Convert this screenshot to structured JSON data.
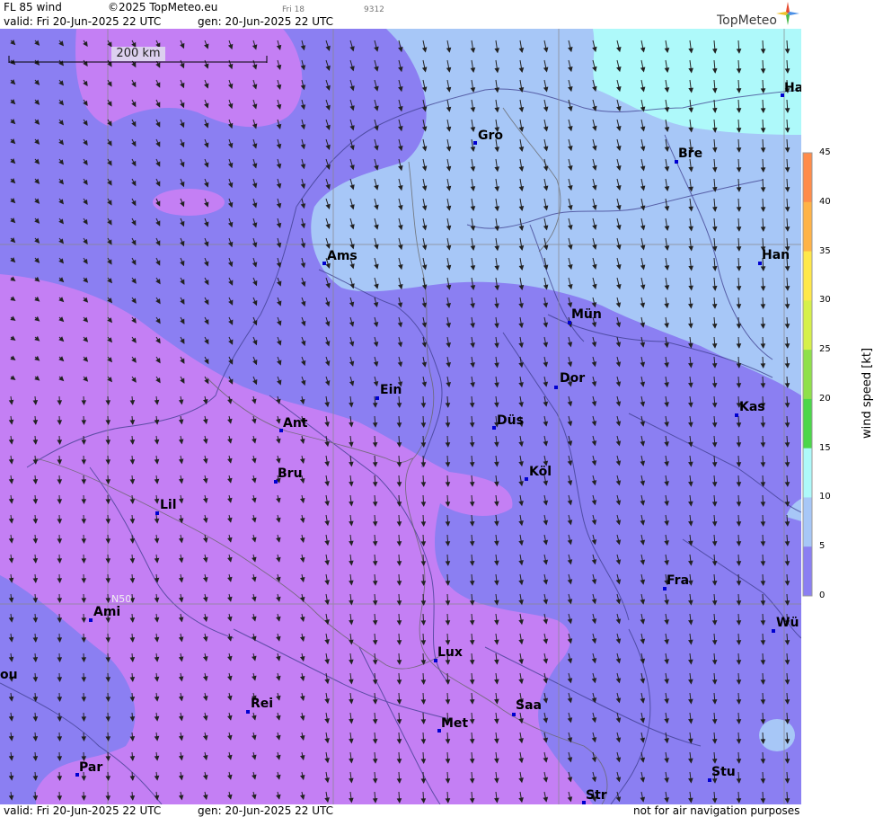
{
  "header": {
    "product": "FL 85 wind",
    "copyright": "©2025 TopMeteo.eu",
    "frame": "Fri 18",
    "code": "9312",
    "valid": "valid:  Fri  20-Jun-2025  22 UTC",
    "gen": "gen: 20-Jun-2025  22 UTC",
    "brand": "TopMeteo"
  },
  "footer": {
    "valid": "valid:  Fri  20-Jun-2025  22 UTC",
    "gen": "gen: 20-Jun-2025  22 UTC",
    "disclaimer": "not for air navigation purposes"
  },
  "map": {
    "scale_label": "200 km",
    "latitude_label": "N50",
    "cities": [
      {
        "name": "Gro"
      },
      {
        "name": "Bre"
      },
      {
        "name": "Ha"
      },
      {
        "name": "Ams"
      },
      {
        "name": "Han"
      },
      {
        "name": "Mün"
      },
      {
        "name": "Dor"
      },
      {
        "name": "Ein"
      },
      {
        "name": "Kas"
      },
      {
        "name": "Düs"
      },
      {
        "name": "Ant"
      },
      {
        "name": "Bru"
      },
      {
        "name": "Köl"
      },
      {
        "name": "Lil"
      },
      {
        "name": "Fra"
      },
      {
        "name": "Ami"
      },
      {
        "name": "Wü"
      },
      {
        "name": "Lux"
      },
      {
        "name": "ou"
      },
      {
        "name": "Rei"
      },
      {
        "name": "Saa"
      },
      {
        "name": "Met"
      },
      {
        "name": "Par"
      },
      {
        "name": "Stu"
      },
      {
        "name": "Str"
      }
    ]
  },
  "colorbar": {
    "label": "wind  speed  [kt]",
    "ticks": [
      "45",
      "40",
      "35",
      "30",
      "25",
      "20",
      "15",
      "10",
      "5",
      "0"
    ],
    "colors": [
      "#ff6f5a",
      "#ff8c4a",
      "#ffb347",
      "#ffe84a",
      "#d6f04a",
      "#8fe04a",
      "#4cd64a",
      "#aef9fa",
      "#a7c7f7",
      "#8b7ff2",
      "#c47ff4"
    ]
  },
  "palette": {
    "calm": "#c47ff4",
    "light": "#8b7ff2",
    "moderate": "#a7c7f7",
    "fresh": "#aef9fa"
  }
}
